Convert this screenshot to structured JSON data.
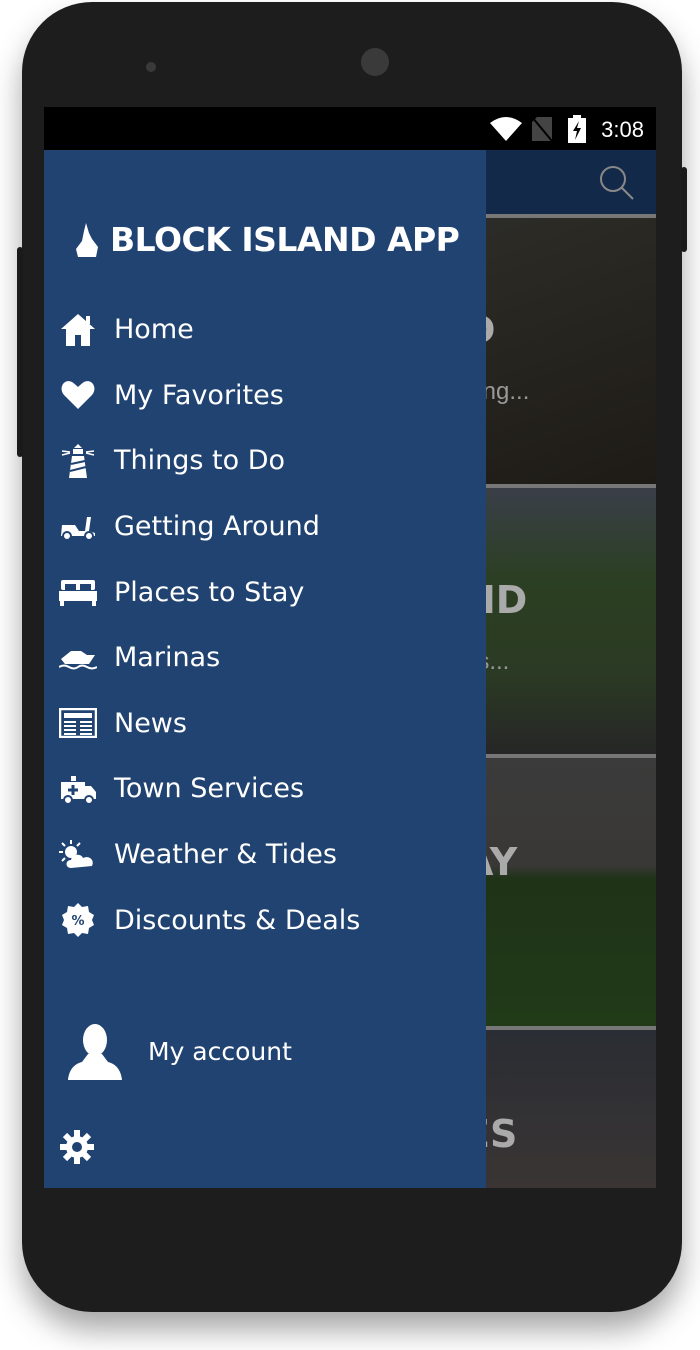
{
  "status_bar": {
    "time": "3:08",
    "icons": [
      "wifi-icon",
      "no-sim-icon",
      "battery-charging-icon"
    ]
  },
  "app_bar": {
    "search_icon": "search-icon"
  },
  "background_cards": [
    {
      "title": "D",
      "subtitle": "ping..."
    },
    {
      "title": "ND",
      "subtitle": "es..."
    },
    {
      "title": "AY",
      "subtitle": ""
    },
    {
      "title": "ES",
      "subtitle": ""
    }
  ],
  "drawer": {
    "brand": "BLOCK ISLAND APP",
    "items": [
      {
        "label": "Home",
        "icon": "home-icon"
      },
      {
        "label": "My Favorites",
        "icon": "heart-icon"
      },
      {
        "label": "Things to Do",
        "icon": "lighthouse-icon"
      },
      {
        "label": "Getting Around",
        "icon": "moped-icon"
      },
      {
        "label": "Places to Stay",
        "icon": "bed-icon"
      },
      {
        "label": "Marinas",
        "icon": "boat-icon"
      },
      {
        "label": "News",
        "icon": "newspaper-icon"
      },
      {
        "label": "Town Services",
        "icon": "ambulance-icon"
      },
      {
        "label": "Weather & Tides",
        "icon": "weather-icon"
      },
      {
        "label": "Discounts & Deals",
        "icon": "discount-badge-icon"
      }
    ],
    "account_label": "My account",
    "settings_icon": "gear-icon"
  },
  "colors": {
    "drawer": "#214372",
    "app_bar": "#13294a"
  }
}
